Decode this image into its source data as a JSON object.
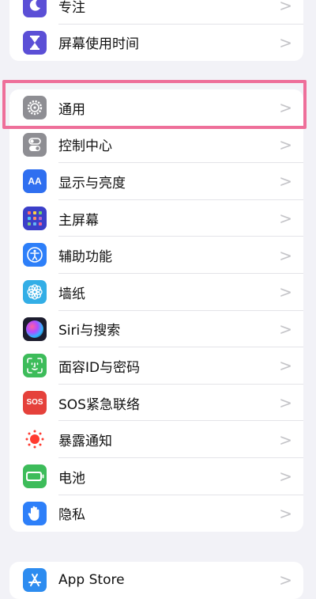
{
  "group1": [
    {
      "label": "专注",
      "icon": "moon-icon",
      "color": "#5b4fd6"
    },
    {
      "label": "屏幕使用时间",
      "icon": "hourglass-icon",
      "color": "#5b4fd6"
    }
  ],
  "group2": [
    {
      "label": "通用",
      "icon": "gear-icon",
      "color": "#8e8e93"
    },
    {
      "label": "控制中心",
      "icon": "toggles-icon",
      "color": "#8e8e93"
    },
    {
      "label": "显示与亮度",
      "icon": "text-size-icon",
      "color": "#2f6ff0",
      "glyph": "AA"
    },
    {
      "label": "主屏幕",
      "icon": "home-grid-icon",
      "color": "#3b3fc9"
    },
    {
      "label": "辅助功能",
      "icon": "accessibility-icon",
      "color": "#2d7ff9"
    },
    {
      "label": "墙纸",
      "icon": "wallpaper-flower-icon",
      "color": "#33aee6"
    },
    {
      "label": "Siri与搜索",
      "icon": "siri-icon",
      "color": "#1c1c2e"
    },
    {
      "label": "面容ID与密码",
      "icon": "face-id-icon",
      "color": "#3dbc5a"
    },
    {
      "label": "SOS紧急联络",
      "icon": "sos-icon",
      "color": "#e5413b",
      "glyph": "SOS"
    },
    {
      "label": "暴露通知",
      "icon": "exposure-notification-icon",
      "color": "#ffffff"
    },
    {
      "label": "电池",
      "icon": "battery-icon",
      "color": "#3dbc5a"
    },
    {
      "label": "隐私",
      "icon": "hand-icon",
      "color": "#2d7ff9"
    }
  ],
  "group3": [
    {
      "label": "App Store",
      "icon": "app-store-icon",
      "color": "#2d8cf0"
    }
  ],
  "chevron": ">",
  "highlight_color": "#ee6f9a"
}
